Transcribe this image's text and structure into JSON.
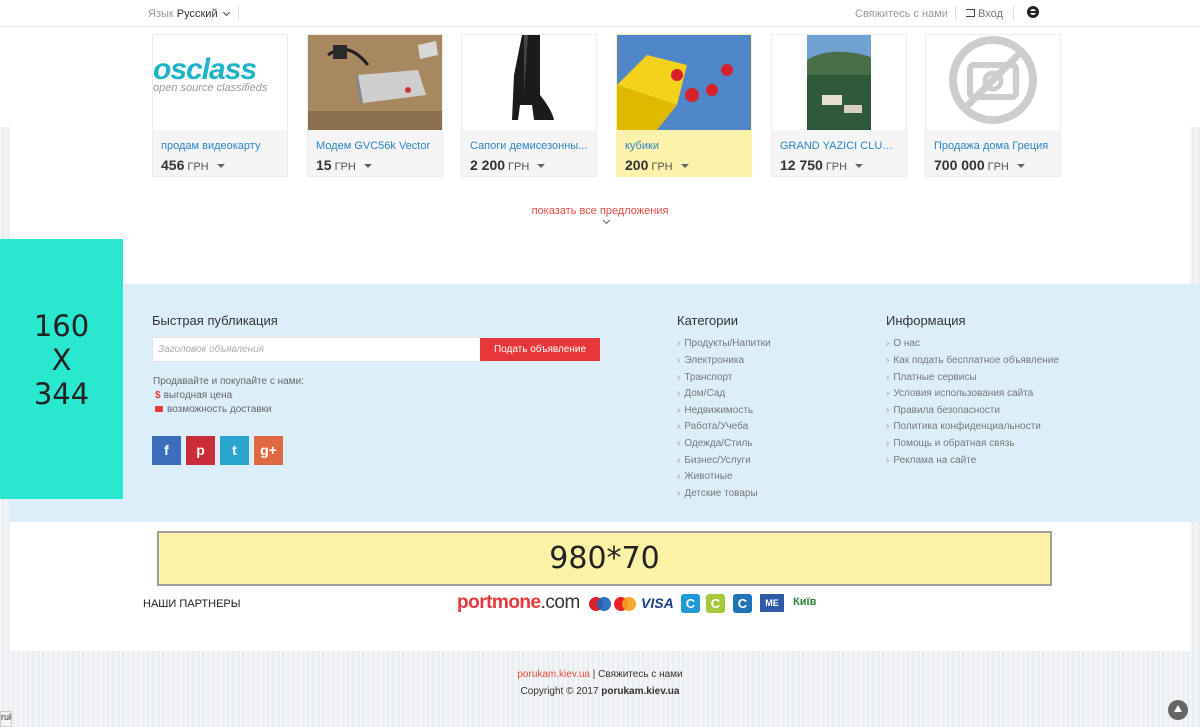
{
  "topbar": {
    "lang_label": "Язык",
    "lang_value": "Русский",
    "contact": "Свяжитесь с нами",
    "login": "Вход"
  },
  "products": [
    {
      "title": "продам видеокарту",
      "price": "456",
      "currency": "ГРН",
      "image": "osclass-logo",
      "logo_main": "osclass",
      "logo_sub": "open source classifieds"
    },
    {
      "title": "Модем GVC56k Vector",
      "price": "15",
      "currency": "ГРН",
      "image": "modem-photo"
    },
    {
      "title": "Сапоги демисезонны...",
      "price": "2 200",
      "currency": "ГРН",
      "image": "boots-photo"
    },
    {
      "title": "кубики",
      "price": "200",
      "currency": "ГРН",
      "image": "dice-photo"
    },
    {
      "title": "GRAND YAZICI CLUB TU...",
      "price": "12 750",
      "currency": "ГРН",
      "image": "resort-photo"
    },
    {
      "title": "Продажа дома Греция",
      "price": "700 000",
      "currency": "ГРН",
      "image": "no-photo-placeholder"
    }
  ],
  "show_all": "показать все предложения",
  "ad_side": {
    "line1": "160",
    "line2": "X",
    "line3": "344"
  },
  "quick": {
    "title": "Быстрая публикация",
    "placeholder": "Заголовок объявления",
    "button": "Подать объявление",
    "promo": "Продавайте и покупайте с нами:",
    "feature1": "выгодная цена",
    "feature2": "возможность доставки"
  },
  "social": {
    "facebook": "f",
    "pinterest": "p",
    "twitter": "t",
    "google": "g+"
  },
  "categories": {
    "title": "Категории",
    "items": [
      "Продукты/Напитки",
      "Электроника",
      "Транспорт",
      "Дом/Сад",
      "Недвижимость",
      "Работа/Учеба",
      "Одежда/Стиль",
      "Бизнес/Услуги",
      "Животные",
      "Детские товары"
    ]
  },
  "info": {
    "title": "Информация",
    "items": [
      "О нас",
      "Как подать бесплатное объявление",
      "Платные сервисы",
      "Условия использования сайта",
      "Правила безопасности",
      "Политика конфиденциальности",
      "Помощь и обратная связь",
      "Реклама на сайте"
    ]
  },
  "banner": "980*70",
  "partners": {
    "label": "НАШИ ПАРТНЕРЫ",
    "portmone": "portmone",
    "portmone_tld": ".com",
    "visa": "VISA",
    "kyiv": "Київ"
  },
  "footer": {
    "site": "porukam.kiev.ua",
    "divider": "|",
    "contact": "Свяжитесь с нами",
    "copyright": "Copyright © 2017",
    "copyright_site": "porukam.kiev.ua"
  },
  "status_text": "ruk",
  "colors": {
    "accent": "#e8373b",
    "link": "#2d84c4",
    "highlight": "#fcf2ab",
    "footer_bg": "#ddeefb",
    "ad_side": "#2ae8d0"
  }
}
